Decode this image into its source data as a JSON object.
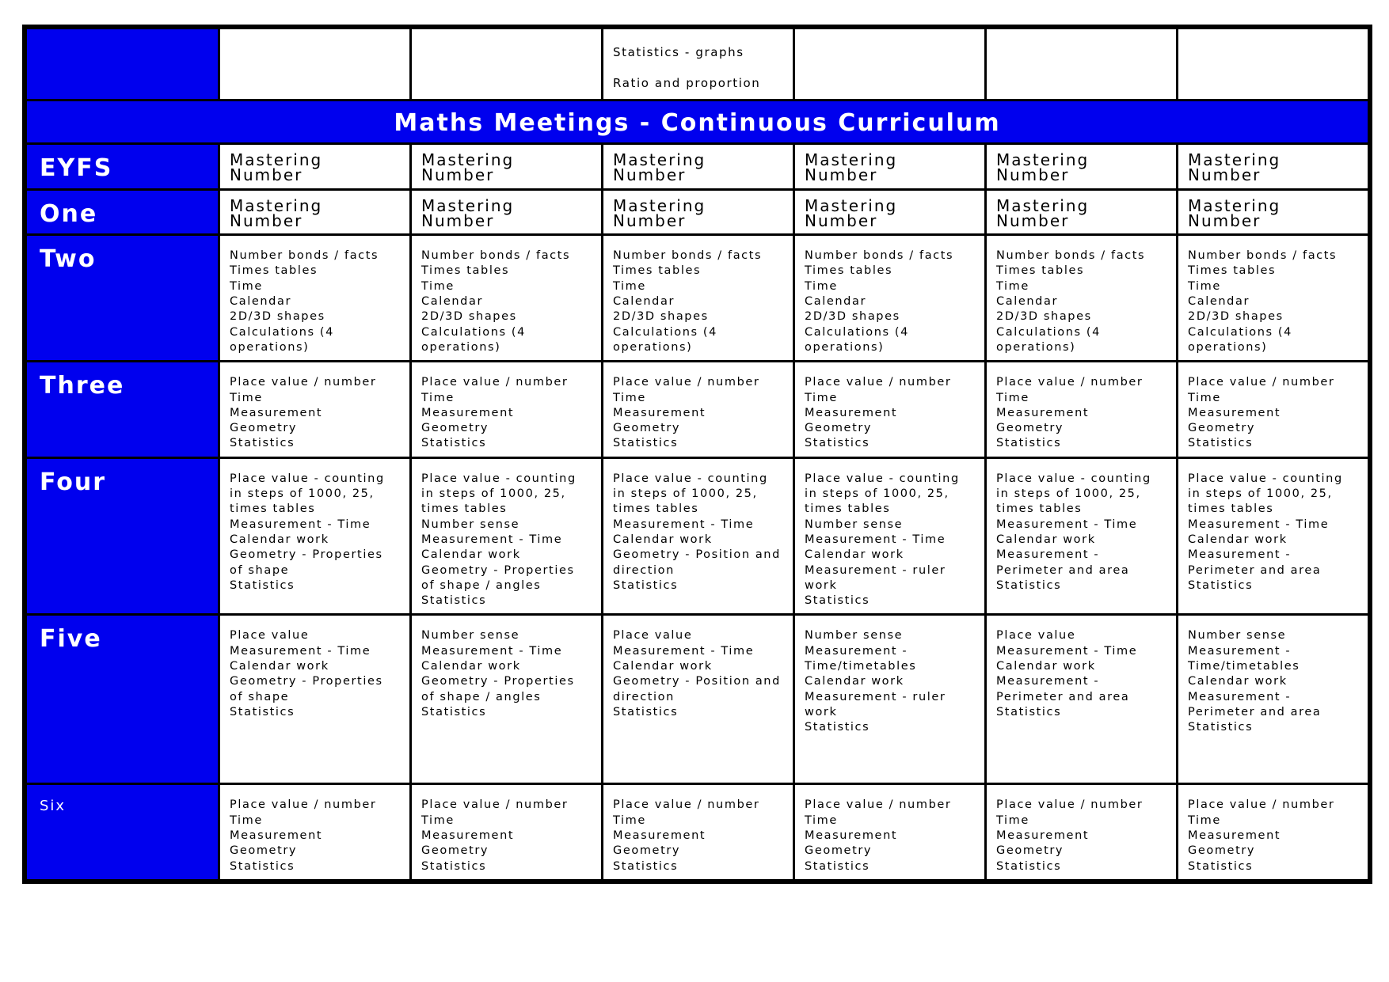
{
  "document": {
    "title": "Maths Meetings - Continuous Curriculum",
    "accent_color": "#0000ee",
    "top_row": {
      "cells": [
        [],
        [],
        [
          "Statistics - graphs",
          "Ratio and proportion"
        ],
        [],
        [],
        []
      ]
    },
    "rows": [
      {
        "label": "EYFS",
        "cells": [
          [
            "Mastering Number"
          ],
          [
            "Mastering Number"
          ],
          [
            "Mastering Number"
          ],
          [
            "Mastering Number"
          ],
          [
            "Mastering Number"
          ],
          [
            "Mastering Number"
          ]
        ]
      },
      {
        "label": "One",
        "cells": [
          [
            "Mastering Number"
          ],
          [
            "Mastering Number"
          ],
          [
            "Mastering Number"
          ],
          [
            "Mastering Number"
          ],
          [
            "Mastering Number"
          ],
          [
            "Mastering Number"
          ]
        ]
      },
      {
        "label": "Two",
        "cells": [
          [
            "Number bonds / facts",
            "Times tables",
            "Time",
            "Calendar",
            "2D/3D shapes",
            "Calculations (4 operations)"
          ],
          [
            "Number bonds / facts",
            "Times tables",
            "Time",
            "Calendar",
            "2D/3D shapes",
            "Calculations (4 operations)"
          ],
          [
            "Number bonds / facts",
            "Times tables",
            "Time",
            "Calendar",
            "2D/3D shapes",
            "Calculations (4 operations)"
          ],
          [
            "Number bonds / facts",
            "Times tables",
            "Time",
            "Calendar",
            "2D/3D shapes",
            "Calculations (4 operations)"
          ],
          [
            "Number bonds / facts",
            "Times tables",
            "Time",
            "Calendar",
            "2D/3D shapes",
            "Calculations (4 operations)"
          ],
          [
            "Number bonds / facts",
            "Times tables",
            "Time",
            "Calendar",
            "2D/3D shapes",
            "Calculations (4 operations)"
          ]
        ]
      },
      {
        "label": "Three",
        "cells": [
          [
            "Place value / number",
            "Time",
            "Measurement",
            "Geometry",
            "Statistics"
          ],
          [
            "Place value / number",
            "Time",
            "Measurement",
            "Geometry",
            "Statistics"
          ],
          [
            "Place value / number",
            "Time",
            "Measurement",
            "Geometry",
            "Statistics"
          ],
          [
            "Place value / number",
            "Time",
            "Measurement",
            "Geometry",
            "Statistics"
          ],
          [
            "Place value / number",
            "Time",
            "Measurement",
            "Geometry",
            "Statistics"
          ],
          [
            "Place value / number",
            "Time",
            "Measurement",
            "Geometry",
            "Statistics"
          ]
        ]
      },
      {
        "label": "Four",
        "cells": [
          [
            "Place value - counting in steps of 1000, 25, times tables",
            "Measurement - Time",
            "Calendar work",
            "Geometry -  Properties of shape",
            "Statistics"
          ],
          [
            "Place value - counting in steps of 1000, 25, times tables",
            "Number sense",
            "Measurement - Time",
            "Calendar work",
            "Geometry - Properties of shape / angles",
            "Statistics"
          ],
          [
            "Place value - counting in steps of 1000, 25, times tables",
            "Measurement - Time",
            "Calendar work",
            "Geometry - Position and direction",
            "Statistics"
          ],
          [
            "Place value - counting in steps of 1000, 25, times tables",
            "Number sense",
            "Measurement - Time",
            "Calendar work",
            "Measurement - ruler work",
            "Statistics"
          ],
          [
            "Place value - counting in steps of 1000, 25, times tables",
            "Measurement - Time",
            "Calendar work",
            "Measurement - Perimeter and area",
            "Statistics"
          ],
          [
            "Place value - counting in steps of 1000, 25, times tables",
            "Measurement - Time",
            "Calendar work",
            "Measurement - Perimeter and area",
            "Statistics"
          ]
        ]
      },
      {
        "label": "Five",
        "cells": [
          [
            "Place value",
            "Measurement - Time",
            "Calendar work",
            "Geometry - Properties of shape",
            "Statistics"
          ],
          [
            "Number sense",
            "Measurement - Time",
            "Calendar work",
            "Geometry - Properties of shape / angles",
            "Statistics"
          ],
          [
            "Place value",
            "Measurement - Time",
            "Calendar work",
            "Geometry - Position and direction",
            "Statistics"
          ],
          [
            "Number sense",
            "Measurement - Time/timetables",
            "Calendar work",
            "Measurement - ruler work",
            "Statistics"
          ],
          [
            "Place value",
            "Measurement - Time",
            "Calendar work",
            "Measurement - Perimeter and area",
            "Statistics"
          ],
          [
            "Number sense",
            "Measurement - Time/timetables",
            "Calendar work",
            "Measurement - Perimeter and area",
            "Statistics"
          ]
        ]
      },
      {
        "label": "Six",
        "cells": [
          [
            "Place value / number",
            "Time",
            "Measurement",
            "Geometry",
            "Statistics"
          ],
          [
            "Place value / number",
            "Time",
            "Measurement",
            "Geometry",
            "Statistics"
          ],
          [
            "Place value / number",
            "Time",
            "Measurement",
            "Geometry",
            "Statistics"
          ],
          [
            "Place value / number",
            "Time",
            "Measurement",
            "Geometry",
            "Statistics"
          ],
          [
            "Place value / number",
            "Time",
            "Measurement",
            "Geometry",
            "Statistics"
          ],
          [
            "Place value / number",
            "Time",
            "Measurement",
            "Geometry",
            "Statistics"
          ]
        ]
      }
    ]
  }
}
